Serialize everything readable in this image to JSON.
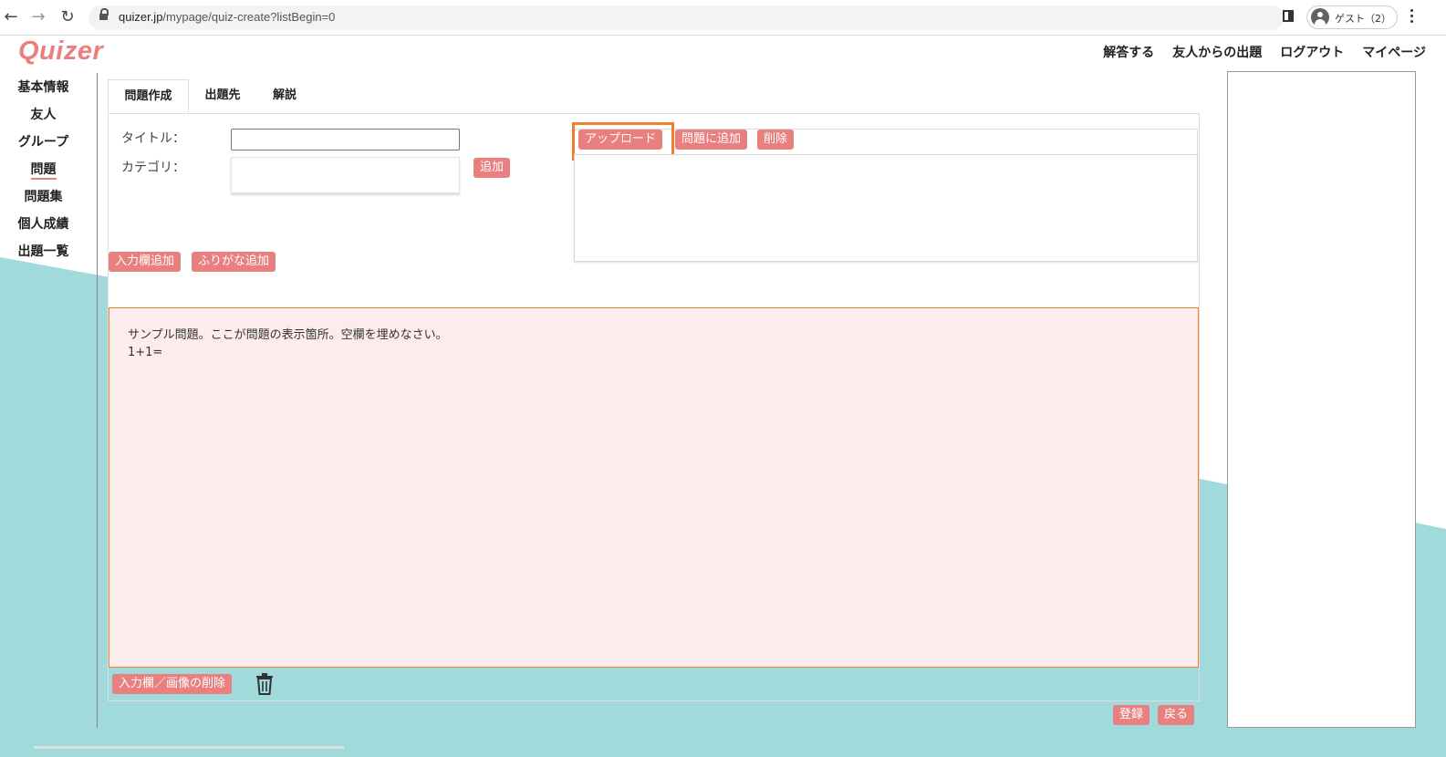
{
  "browser": {
    "url_host": "quizer.jp",
    "url_path": "/mypage/quiz-create?listBegin=0",
    "profile_label": "ゲスト（2）"
  },
  "header": {
    "logo": "Quizer",
    "nav": [
      "解答する",
      "友人からの出題",
      "ログアウト",
      "マイページ"
    ]
  },
  "sidebar": {
    "items": [
      {
        "label": "基本情報"
      },
      {
        "label": "友人"
      },
      {
        "label": "グループ"
      },
      {
        "label": "問題"
      },
      {
        "label": "問題集"
      },
      {
        "label": "個人成績"
      },
      {
        "label": "出題一覧"
      }
    ],
    "active": "問題"
  },
  "tabs": [
    {
      "label": "問題作成",
      "active": true
    },
    {
      "label": "出題先",
      "active": false
    },
    {
      "label": "解説",
      "active": false
    }
  ],
  "form": {
    "title_label": "タイトル：",
    "title_value": "",
    "category_label": "カテゴリ：",
    "add_category_button": "追加",
    "add_input_button": "入力欄追加",
    "add_furigana_button": "ふりがな追加"
  },
  "upload": {
    "upload_button": "アップロード",
    "add_to_question_button": "問題に追加",
    "delete_button": "削除"
  },
  "question": {
    "line1": "サンプル問題。ここが問題の表示箇所。空欄を埋めなさい。",
    "line2": "1+1="
  },
  "footer_actions": {
    "delete_input_image_button": "入力欄／画像の削除",
    "register_button": "登録",
    "back_button": "戻る"
  },
  "colors": {
    "accent": "#e98080",
    "teal_background": "#a0dadb",
    "question_bg": "#fdecec",
    "highlight": "#f0802e"
  }
}
